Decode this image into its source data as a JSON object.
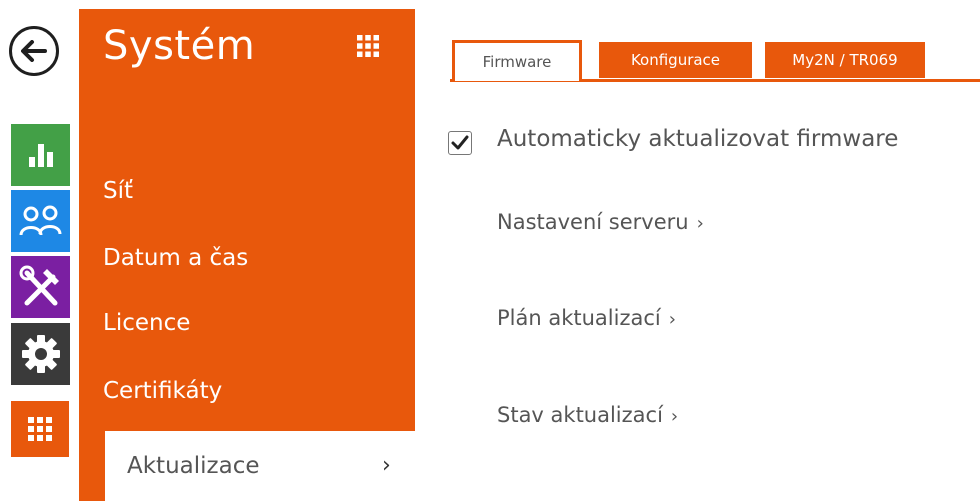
{
  "rail": {
    "back": "arrow-left-icon",
    "items": [
      {
        "name": "status",
        "icon": "bar-chart-icon",
        "color": "#43a047"
      },
      {
        "name": "directory",
        "icon": "users-icon",
        "color": "#1e88e5"
      },
      {
        "name": "services",
        "icon": "tools-icon",
        "color": "#7b1fa2"
      },
      {
        "name": "hardware",
        "icon": "gear-icon",
        "color": "#3a3a3a"
      },
      {
        "name": "system",
        "icon": "grid-icon",
        "color": "#e8580c"
      }
    ]
  },
  "menu": {
    "title": "Systém",
    "grid_icon": "grid-icon",
    "items": [
      {
        "label": "Síť"
      },
      {
        "label": "Datum a čas"
      },
      {
        "label": "Licence"
      },
      {
        "label": "Certifikáty"
      },
      {
        "label": "Aktualizace",
        "active": true,
        "chevron": "›"
      }
    ]
  },
  "tabs": [
    {
      "label": "Firmware",
      "active": true
    },
    {
      "label": "Konfigurace",
      "active": false
    },
    {
      "label": "My2N / TR069",
      "active": false
    }
  ],
  "content": {
    "auto_update": {
      "label": "Automaticky aktualizovat firmware",
      "checked": true
    },
    "links": [
      {
        "label": "Nastavení serveru",
        "chevron": "›"
      },
      {
        "label": "Plán aktualizací",
        "chevron": "›"
      },
      {
        "label": "Stav aktualizací",
        "chevron": "›"
      }
    ]
  },
  "colors": {
    "accent": "#e8580c",
    "status": "#43a047",
    "directory": "#1e88e5",
    "services": "#7b1fa2",
    "hardware": "#3a3a3a"
  }
}
